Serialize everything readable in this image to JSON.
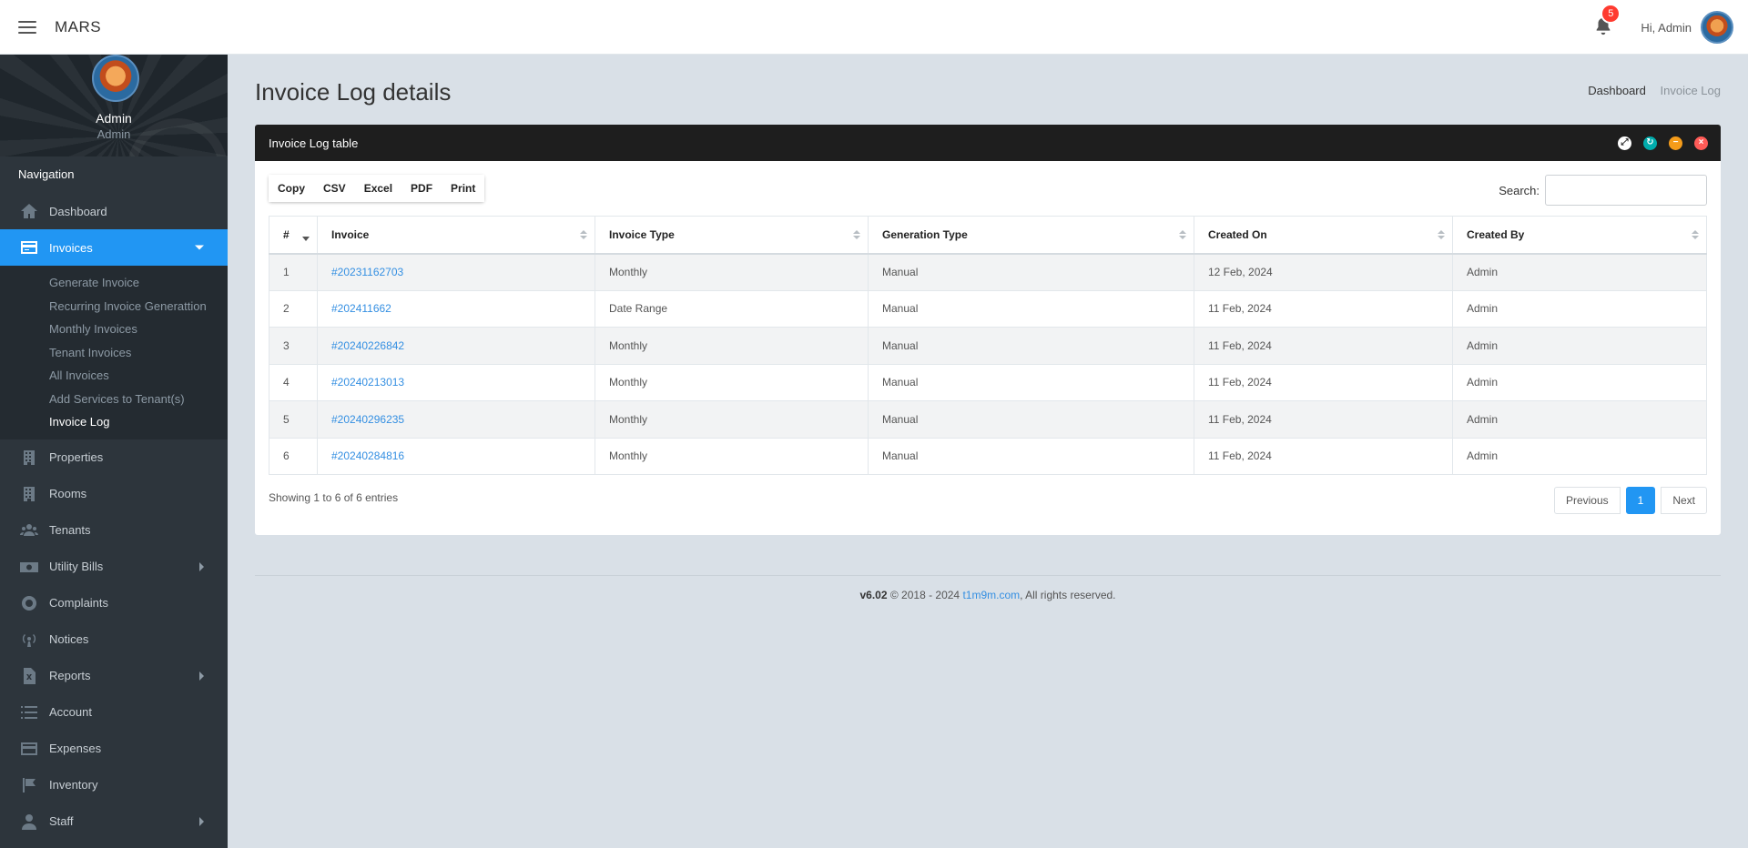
{
  "app": {
    "brand": "MARS"
  },
  "header": {
    "notification_count": "5",
    "greeting": "Hi, Admin"
  },
  "sidebar": {
    "profile": {
      "name": "Admin",
      "role": "Admin"
    },
    "nav_header": "Navigation",
    "items": [
      {
        "label": "Dashboard",
        "icon": "home-icon"
      },
      {
        "label": "Invoices",
        "icon": "credit-card-icon",
        "active": true
      },
      {
        "label": "Properties",
        "icon": "building-icon"
      },
      {
        "label": "Rooms",
        "icon": "building-icon"
      },
      {
        "label": "Tenants",
        "icon": "users-icon"
      },
      {
        "label": "Utility Bills",
        "icon": "money-bill-icon"
      },
      {
        "label": "Complaints",
        "icon": "life-ring-icon"
      },
      {
        "label": "Notices",
        "icon": "broadcast-icon"
      },
      {
        "label": "Reports",
        "icon": "file-excel-icon"
      },
      {
        "label": "Account",
        "icon": "list-icon"
      },
      {
        "label": "Expenses",
        "icon": "credit-card-icon"
      },
      {
        "label": "Inventory",
        "icon": "flag-icon"
      },
      {
        "label": "Staff",
        "icon": "user-icon"
      }
    ],
    "invoices_submenu": [
      "Generate Invoice",
      "Recurring Invoice Generattion",
      "Monthly Invoices",
      "Tenant Invoices",
      "All Invoices",
      "Add Services to Tenant(s)",
      "Invoice Log"
    ]
  },
  "page": {
    "title": "Invoice Log details",
    "breadcrumb": {
      "home": "Dashboard",
      "current": "Invoice Log"
    }
  },
  "panel": {
    "title": "Invoice Log table",
    "buttons": {
      "copy": "Copy",
      "csv": "CSV",
      "excel": "Excel",
      "pdf": "PDF",
      "print": "Print"
    },
    "search_label": "Search:",
    "search_value": "",
    "columns": [
      "#",
      "Invoice",
      "Invoice Type",
      "Generation Type",
      "Created On",
      "Created By"
    ],
    "rows": [
      {
        "num": "1",
        "invoice": "#20231162703",
        "invoice_type": "Monthly",
        "generation_type": "Manual",
        "created_on": "12 Feb, 2024",
        "created_by": "Admin"
      },
      {
        "num": "2",
        "invoice": "#202411662",
        "invoice_type": "Date Range",
        "generation_type": "Manual",
        "created_on": "11 Feb, 2024",
        "created_by": "Admin"
      },
      {
        "num": "3",
        "invoice": "#20240226842",
        "invoice_type": "Monthly",
        "generation_type": "Manual",
        "created_on": "11 Feb, 2024",
        "created_by": "Admin"
      },
      {
        "num": "4",
        "invoice": "#20240213013",
        "invoice_type": "Monthly",
        "generation_type": "Manual",
        "created_on": "11 Feb, 2024",
        "created_by": "Admin"
      },
      {
        "num": "5",
        "invoice": "#20240296235",
        "invoice_type": "Monthly",
        "generation_type": "Manual",
        "created_on": "11 Feb, 2024",
        "created_by": "Admin"
      },
      {
        "num": "6",
        "invoice": "#20240284816",
        "invoice_type": "Monthly",
        "generation_type": "Manual",
        "created_on": "11 Feb, 2024",
        "created_by": "Admin"
      }
    ],
    "info": "Showing 1 to 6 of 6 entries",
    "pagination": {
      "previous": "Previous",
      "page": "1",
      "next": "Next"
    }
  },
  "footer": {
    "version": "v6.02",
    "copyright": " © 2018 - 2024 ",
    "link": "t1m9m.com",
    "rights": ", All rights reserved."
  },
  "colors": {
    "accent": "#2196f3",
    "sidebar_bg": "#2d353c",
    "panel_heading": "#1e1e1e",
    "link": "#348fe2",
    "badge": "#ff3b30",
    "tool_expand": "#ffffff",
    "tool_reload": "#00acac",
    "tool_collapse": "#f59c1a",
    "tool_remove": "#ff5b57"
  }
}
